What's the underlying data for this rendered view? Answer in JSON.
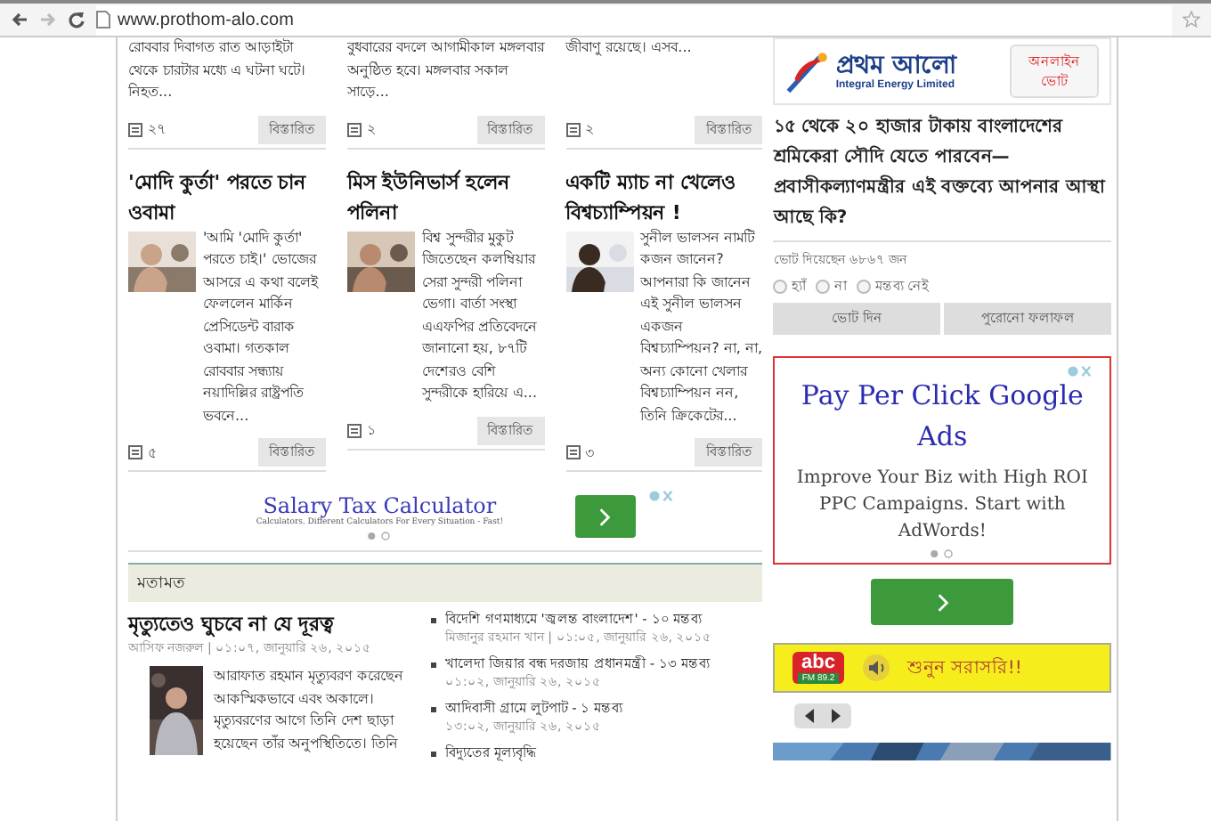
{
  "browser": {
    "url": "www.prothom-alo.com"
  },
  "top_articles": [
    {
      "excerpt": "রোববার দিবাগত রাত আড়াইটা থেকে চারটার মধ্যে এ ঘটনা ঘটে। নিহত...",
      "comments": "২৭",
      "more": "বিস্তারিত"
    },
    {
      "excerpt": "বুধবারের বদলে আগামীকাল মঙ্গলবার অনুষ্ঠিত হবে। মঙ্গলবার সকাল সাড়ে...",
      "comments": "২",
      "more": "বিস্তারিত"
    },
    {
      "excerpt": "জীবাণু রয়েছে। এসব...",
      "comments": "২",
      "more": "বিস্তারিত"
    }
  ],
  "articles": [
    {
      "title": "'মোদি কুর্তা' পরতে চান ওবামা",
      "excerpt": "'আমি 'মোদি কুর্তা' পরতে চাই।' ভোজের আসরে এ কথা বলেই ফেললেন মার্কিন প্রেসিডেন্ট বারাক ওবামা। গতকাল রোববার সন্ধ্যায় নয়াদিল্লির রাষ্ট্রপতি ভবনে...",
      "comments": "৫",
      "more": "বিস্তারিত"
    },
    {
      "title": "মিস ইউনিভার্স হলেন পলিনা",
      "excerpt": "বিশ্ব সুন্দরীর মুকুট জিতেছেন কলম্বিয়ার সেরা সুন্দরী পলিনা ভেগা। বার্তা সংস্থা এএফপির প্রতিবেদনে জানানো হয়, ৮৭টি দেশেরও বেশি সুন্দরীকে হারিয়ে এ...",
      "comments": "১",
      "more": "বিস্তারিত"
    },
    {
      "title": "একটি ম্যাচ না খেলেও বিশ্বচ্যাম্পিয়ন !",
      "excerpt": "সুনীল ভালসন নামটি কজন জানেন? আপনারা কি জানেন এই সুনীল ভালসন একজন বিশ্বচ্যাম্পিয়ন? না, না, অন্য কোনো খেলার বিশ্বচ্যাম্পিয়ন নন, তিনি ক্রিকেটের...",
      "comments": "৩",
      "more": "বিস্তারিত"
    }
  ],
  "ad_banner": {
    "title": "Salary Tax Calculator",
    "subtitle": "Calculators. Different Calculators For Every Situation - Fast!"
  },
  "opinion": {
    "heading": "মতামত",
    "lead": {
      "title": "মৃত্যুতেও ঘুচবে না যে দূরত্ব",
      "byline": "আসিফ নজরুল | ০১:০৭, জানুয়ারি ২৬, ২০১৫",
      "excerpt": "আরাফাত রহমান মৃত্যুবরণ করেছেন আকস্মিকভাবে এবং অকালে। মৃত্যুবরণের আগে তিনি দেশ ছাড়া হয়েছেন তাঁর অনুপস্থিতিতে। তিনি"
    },
    "list": [
      {
        "title": "বিদেশি গণমাধ্যমে 'জ্বলন্ত বাংলাদেশ' - ১০ মন্তব্য",
        "meta": "মিজানুর রহমান খান | ০১:০৫, জানুয়ারি ২৬, ২০১৫"
      },
      {
        "title": "খালেদা জিয়ার বন্ধ দরজায় প্রধানমন্ত্রী - ১৩ মন্তব্য",
        "meta": "০১:০২, জানুয়ারি ২৬, ২০১৫"
      },
      {
        "title": "আদিবাসী গ্রামে লুটপাট - ১ মন্তব্য",
        "meta": "১৩:০২, জানুয়ারি ২৬, ২০১৫"
      },
      {
        "title": "বিদ্যুতের মূল্যবৃদ্ধি"
      }
    ]
  },
  "sidebar": {
    "logo": {
      "name": "প্রথম আলো",
      "sponsor": "Integral Energy Limited"
    },
    "poll_button": "অনলাইন ভোট",
    "question": "১৫ থেকে ২০ হাজার টাকায় বাংলাদেশের শ্রমিকেরা সৌদি যেতে পারবেন—প্রবাসীকল্যাণমন্ত্রীর এই বক্তব্যে আপনার আস্থা আছে কি?",
    "vote_count": "ভোট দিয়েছেন ৬৮৬৭ জন",
    "options": [
      {
        "label": "হ্যাঁ",
        "selected": false
      },
      {
        "label": "না",
        "selected": false
      },
      {
        "label": "মন্তব্য নেই",
        "selected": false
      }
    ],
    "buttons": [
      "ভোট দিন",
      "পুরোনো ফলাফল"
    ],
    "ad": {
      "title": "Pay Per Click Google Ads",
      "body": "Improve Your Biz with High ROI PPC Campaigns. Start with AdWords!"
    },
    "radio": {
      "logo": "abc",
      "frequency": "FM 89.2",
      "cta": "শুনুন সরাসরি!!"
    }
  }
}
